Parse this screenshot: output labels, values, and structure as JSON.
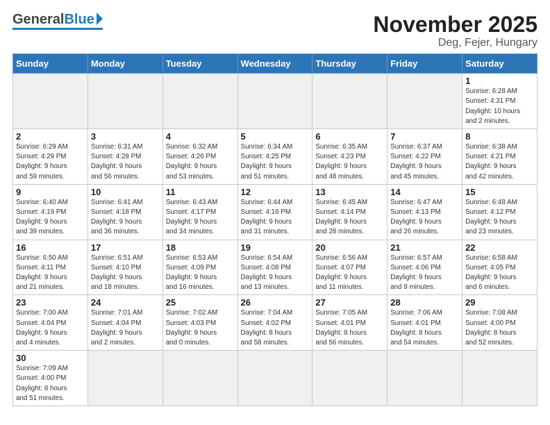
{
  "logo": {
    "general": "General",
    "blue": "Blue"
  },
  "title": "November 2025",
  "location": "Deg, Fejer, Hungary",
  "weekdays": [
    "Sunday",
    "Monday",
    "Tuesday",
    "Wednesday",
    "Thursday",
    "Friday",
    "Saturday"
  ],
  "rows": [
    [
      {
        "day": "",
        "info": ""
      },
      {
        "day": "",
        "info": ""
      },
      {
        "day": "",
        "info": ""
      },
      {
        "day": "",
        "info": ""
      },
      {
        "day": "",
        "info": ""
      },
      {
        "day": "",
        "info": ""
      },
      {
        "day": "1",
        "info": "Sunrise: 6:28 AM\nSunset: 4:31 PM\nDaylight: 10 hours\nand 2 minutes."
      }
    ],
    [
      {
        "day": "2",
        "info": "Sunrise: 6:29 AM\nSunset: 4:29 PM\nDaylight: 9 hours\nand 59 minutes."
      },
      {
        "day": "3",
        "info": "Sunrise: 6:31 AM\nSunset: 4:28 PM\nDaylight: 9 hours\nand 56 minutes."
      },
      {
        "day": "4",
        "info": "Sunrise: 6:32 AM\nSunset: 4:26 PM\nDaylight: 9 hours\nand 53 minutes."
      },
      {
        "day": "5",
        "info": "Sunrise: 6:34 AM\nSunset: 4:25 PM\nDaylight: 9 hours\nand 51 minutes."
      },
      {
        "day": "6",
        "info": "Sunrise: 6:35 AM\nSunset: 4:23 PM\nDaylight: 9 hours\nand 48 minutes."
      },
      {
        "day": "7",
        "info": "Sunrise: 6:37 AM\nSunset: 4:22 PM\nDaylight: 9 hours\nand 45 minutes."
      },
      {
        "day": "8",
        "info": "Sunrise: 6:38 AM\nSunset: 4:21 PM\nDaylight: 9 hours\nand 42 minutes."
      }
    ],
    [
      {
        "day": "9",
        "info": "Sunrise: 6:40 AM\nSunset: 4:19 PM\nDaylight: 9 hours\nand 39 minutes."
      },
      {
        "day": "10",
        "info": "Sunrise: 6:41 AM\nSunset: 4:18 PM\nDaylight: 9 hours\nand 36 minutes."
      },
      {
        "day": "11",
        "info": "Sunrise: 6:43 AM\nSunset: 4:17 PM\nDaylight: 9 hours\nand 34 minutes."
      },
      {
        "day": "12",
        "info": "Sunrise: 6:44 AM\nSunset: 4:16 PM\nDaylight: 9 hours\nand 31 minutes."
      },
      {
        "day": "13",
        "info": "Sunrise: 6:45 AM\nSunset: 4:14 PM\nDaylight: 9 hours\nand 28 minutes."
      },
      {
        "day": "14",
        "info": "Sunrise: 6:47 AM\nSunset: 4:13 PM\nDaylight: 9 hours\nand 26 minutes."
      },
      {
        "day": "15",
        "info": "Sunrise: 6:48 AM\nSunset: 4:12 PM\nDaylight: 9 hours\nand 23 minutes."
      }
    ],
    [
      {
        "day": "16",
        "info": "Sunrise: 6:50 AM\nSunset: 4:11 PM\nDaylight: 9 hours\nand 21 minutes."
      },
      {
        "day": "17",
        "info": "Sunrise: 6:51 AM\nSunset: 4:10 PM\nDaylight: 9 hours\nand 18 minutes."
      },
      {
        "day": "18",
        "info": "Sunrise: 6:53 AM\nSunset: 4:09 PM\nDaylight: 9 hours\nand 16 minutes."
      },
      {
        "day": "19",
        "info": "Sunrise: 6:54 AM\nSunset: 4:08 PM\nDaylight: 9 hours\nand 13 minutes."
      },
      {
        "day": "20",
        "info": "Sunrise: 6:56 AM\nSunset: 4:07 PM\nDaylight: 9 hours\nand 11 minutes."
      },
      {
        "day": "21",
        "info": "Sunrise: 6:57 AM\nSunset: 4:06 PM\nDaylight: 9 hours\nand 9 minutes."
      },
      {
        "day": "22",
        "info": "Sunrise: 6:58 AM\nSunset: 4:05 PM\nDaylight: 9 hours\nand 6 minutes."
      }
    ],
    [
      {
        "day": "23",
        "info": "Sunrise: 7:00 AM\nSunset: 4:04 PM\nDaylight: 9 hours\nand 4 minutes."
      },
      {
        "day": "24",
        "info": "Sunrise: 7:01 AM\nSunset: 4:04 PM\nDaylight: 9 hours\nand 2 minutes."
      },
      {
        "day": "25",
        "info": "Sunrise: 7:02 AM\nSunset: 4:03 PM\nDaylight: 9 hours\nand 0 minutes."
      },
      {
        "day": "26",
        "info": "Sunrise: 7:04 AM\nSunset: 4:02 PM\nDaylight: 8 hours\nand 58 minutes."
      },
      {
        "day": "27",
        "info": "Sunrise: 7:05 AM\nSunset: 4:01 PM\nDaylight: 8 hours\nand 56 minutes."
      },
      {
        "day": "28",
        "info": "Sunrise: 7:06 AM\nSunset: 4:01 PM\nDaylight: 8 hours\nand 54 minutes."
      },
      {
        "day": "29",
        "info": "Sunrise: 7:08 AM\nSunset: 4:00 PM\nDaylight: 8 hours\nand 52 minutes."
      }
    ],
    [
      {
        "day": "30",
        "info": "Sunrise: 7:09 AM\nSunset: 4:00 PM\nDaylight: 8 hours\nand 51 minutes."
      },
      {
        "day": "",
        "info": ""
      },
      {
        "day": "",
        "info": ""
      },
      {
        "day": "",
        "info": ""
      },
      {
        "day": "",
        "info": ""
      },
      {
        "day": "",
        "info": ""
      },
      {
        "day": "",
        "info": ""
      }
    ]
  ]
}
